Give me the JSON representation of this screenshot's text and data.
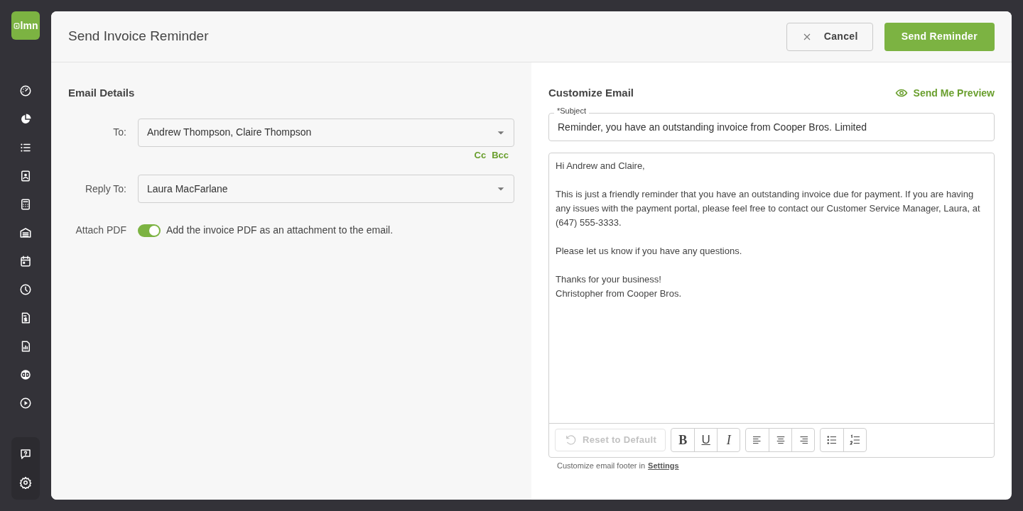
{
  "logo": {
    "text": "lmn"
  },
  "dialog": {
    "title": "Send Invoice Reminder",
    "buttons": [
      {
        "kind": "cancel",
        "label": "Cancel"
      },
      {
        "kind": "primary",
        "label": "Send Reminder"
      }
    ]
  },
  "email_details": {
    "title": "Email Details",
    "to": {
      "label": "To:",
      "value": "Andrew Thompson, Claire Thompson"
    },
    "cc_links": [
      "Cc",
      "Bcc"
    ],
    "reply_to": {
      "label": "Reply To:",
      "value": "Laura MacFarlane"
    },
    "attach_pdf": {
      "label": "Attach PDF",
      "on": true,
      "description": "Add the invoice PDF as an attachment to the email."
    }
  },
  "customize_email": {
    "title": "Customize Email",
    "preview_link": "Send Me Preview",
    "subject": {
      "label": "*Subject",
      "value": "Reminder, you have an outstanding invoice from Cooper Bros. Limited"
    },
    "body": [
      [
        "Hi Andrew and Claire,"
      ],
      [
        "This is just a friendly reminder that you have an outstanding invoice due for payment. If you are having any issues with the payment portal, please feel free to contact our Customer Service Manager, Laura, at (647) 555-3333."
      ],
      [
        "Please let us know if you have any questions."
      ],
      [
        "Thanks for your business!",
        "Christopher from Cooper Bros."
      ]
    ],
    "reset_button": {
      "label": "Reset to Default",
      "disabled": true
    },
    "format_groups": [
      [
        {
          "kind": "bold",
          "label": "B"
        },
        {
          "kind": "underline",
          "label": "U"
        },
        {
          "kind": "italic",
          "label": "I"
        }
      ],
      [
        {
          "kind": "align-left"
        },
        {
          "kind": "align-center"
        },
        {
          "kind": "align-right"
        }
      ],
      [
        {
          "kind": "bullet-list"
        },
        {
          "kind": "numbered-list"
        }
      ]
    ],
    "footer_note": "Customize email footer in",
    "footer_link": "Settings"
  }
}
